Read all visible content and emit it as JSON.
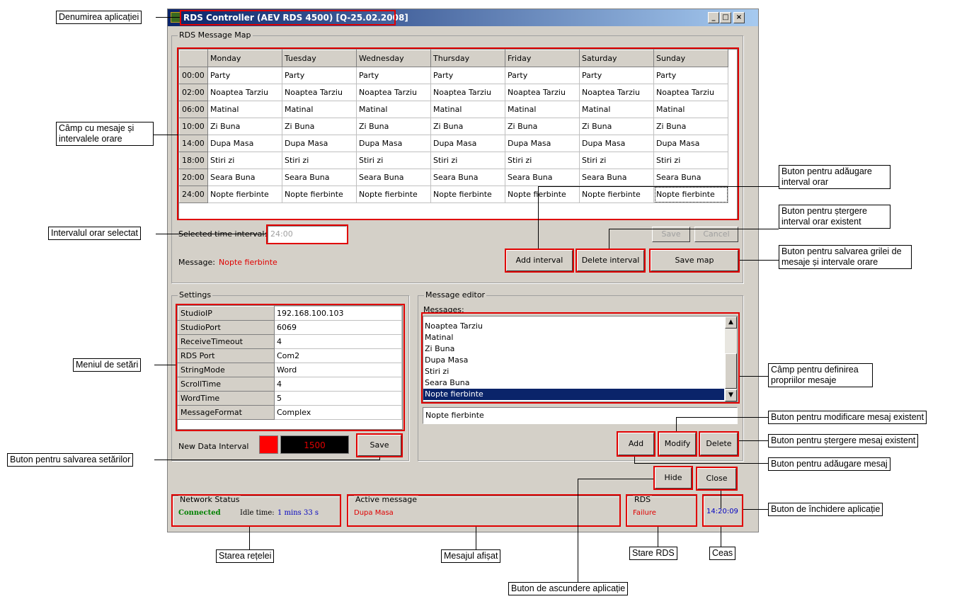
{
  "app": {
    "title": "RDS Controller (AEV RDS 4500)  [Q-25.02.2008]",
    "minimize": "_",
    "maximize": "□",
    "close": "×"
  },
  "map": {
    "legend": "RDS Message Map",
    "days": [
      "Monday",
      "Tuesday",
      "Wednesday",
      "Thursday",
      "Friday",
      "Saturday",
      "Sunday"
    ],
    "rows": [
      {
        "time": "00:00",
        "cells": [
          "Party",
          "Party",
          "Party",
          "Party",
          "Party",
          "Party",
          "Party"
        ]
      },
      {
        "time": "02:00",
        "cells": [
          "Noaptea Tarziu",
          "Noaptea Tarziu",
          "Noaptea Tarziu",
          "Noaptea Tarziu",
          "Noaptea Tarziu",
          "Noaptea Tarziu",
          "Noaptea Tarziu"
        ]
      },
      {
        "time": "06:00",
        "cells": [
          "Matinal",
          "Matinal",
          "Matinal",
          "Matinal",
          "Matinal",
          "Matinal",
          "Matinal"
        ]
      },
      {
        "time": "10:00",
        "cells": [
          "Zi Buna",
          "Zi Buna",
          "Zi Buna",
          "Zi Buna",
          "Zi Buna",
          "Zi Buna",
          "Zi Buna"
        ]
      },
      {
        "time": "14:00",
        "cells": [
          "Dupa Masa",
          "Dupa Masa",
          "Dupa Masa",
          "Dupa Masa",
          "Dupa Masa",
          "Dupa Masa",
          "Dupa Masa"
        ]
      },
      {
        "time": "18:00",
        "cells": [
          "Stiri zi",
          "Stiri zi",
          "Stiri zi",
          "Stiri zi",
          "Stiri zi",
          "Stiri zi",
          "Stiri zi"
        ]
      },
      {
        "time": "20:00",
        "cells": [
          "Seara Buna",
          "Seara Buna",
          "Seara Buna",
          "Seara Buna",
          "Seara Buna",
          "Seara Buna",
          "Seara Buna"
        ]
      },
      {
        "time": "24:00",
        "cells": [
          "Nopte fierbinte",
          "Nopte fierbinte",
          "Nopte fierbinte",
          "Nopte fierbinte",
          "Nopte fierbinte",
          "Nopte fierbinte",
          "Nopte fierbinte"
        ]
      }
    ],
    "selected_label": "Selected time interval:",
    "selected_value": "24:00",
    "message_label": "Message:",
    "message_value": "Nopte fierbinte",
    "save": "Save",
    "cancel": "Cancel",
    "add_interval": "Add interval",
    "delete_interval": "Delete interval",
    "save_map": "Save map"
  },
  "settings": {
    "legend": "Settings",
    "rows": [
      [
        "StudioIP",
        "192.168.100.103"
      ],
      [
        "StudioPort",
        "6069"
      ],
      [
        "ReceiveTimeout",
        "4"
      ],
      [
        "RDS Port",
        "Com2"
      ],
      [
        "StringMode",
        "Word"
      ],
      [
        "ScrollTime",
        "4"
      ],
      [
        "WordTime",
        "5"
      ],
      [
        "MessageFormat",
        "Complex"
      ]
    ],
    "interval_label": "New Data Interval",
    "interval_value": "1500",
    "save": "Save"
  },
  "editor": {
    "legend": "Message editor",
    "messages_label": "Messages:",
    "items": [
      "Noaptea Tarziu",
      "Matinal",
      "Zi Buna",
      "Dupa Masa",
      "Stiri zi",
      "Seara Buna",
      "Nopte fierbinte"
    ],
    "selected": "Nopte fierbinte",
    "edit_value": "Nopte fierbinte",
    "add": "Add",
    "modify": "Modify",
    "delete": "Delete"
  },
  "buttons": {
    "hide": "Hide",
    "close": "Close"
  },
  "status": {
    "network_legend": "Network Status",
    "network_value": "Connected",
    "idle_label": "Idle time:",
    "idle_value": "1 mins 33 s",
    "active_legend": "Active message",
    "active_value": "Dupa Masa",
    "rds_legend": "RDS",
    "rds_value": "Failure",
    "clock": "14:20:09"
  },
  "colors": {
    "accent_red": "#e00000",
    "connected_green": "#008000",
    "clock_blue": "#0000c0",
    "title_blue": "#0a246a"
  },
  "annotations": {
    "app_name": "Denumirea aplicației",
    "grid": "Câmp cu mesaje și intervalele orare",
    "selected": "Intervalul orar selectat",
    "add_interval": "Buton pentru adăugare interval orar",
    "delete_interval": "Buton pentru ștergere interval orar existent",
    "save_map": "Buton pentru salvarea grilei de mesaje și intervale orare",
    "settings_menu": "Meniul de setări",
    "save_settings": "Buton pentru salvarea setărilor",
    "messages_field": "Câmp pentru definirea propriilor mesaje",
    "modify": "Buton pentru modificare mesaj existent",
    "delete": "Buton pentru ștergere mesaj existent",
    "add": "Buton pentru adăugare mesaj",
    "close_app": "Buton de închidere aplicație",
    "network": "Starea rețelei",
    "shown_message": "Mesajul afișat",
    "rds_state": "Stare RDS",
    "clock": "Ceas",
    "hide": "Buton de ascundere aplicație"
  }
}
